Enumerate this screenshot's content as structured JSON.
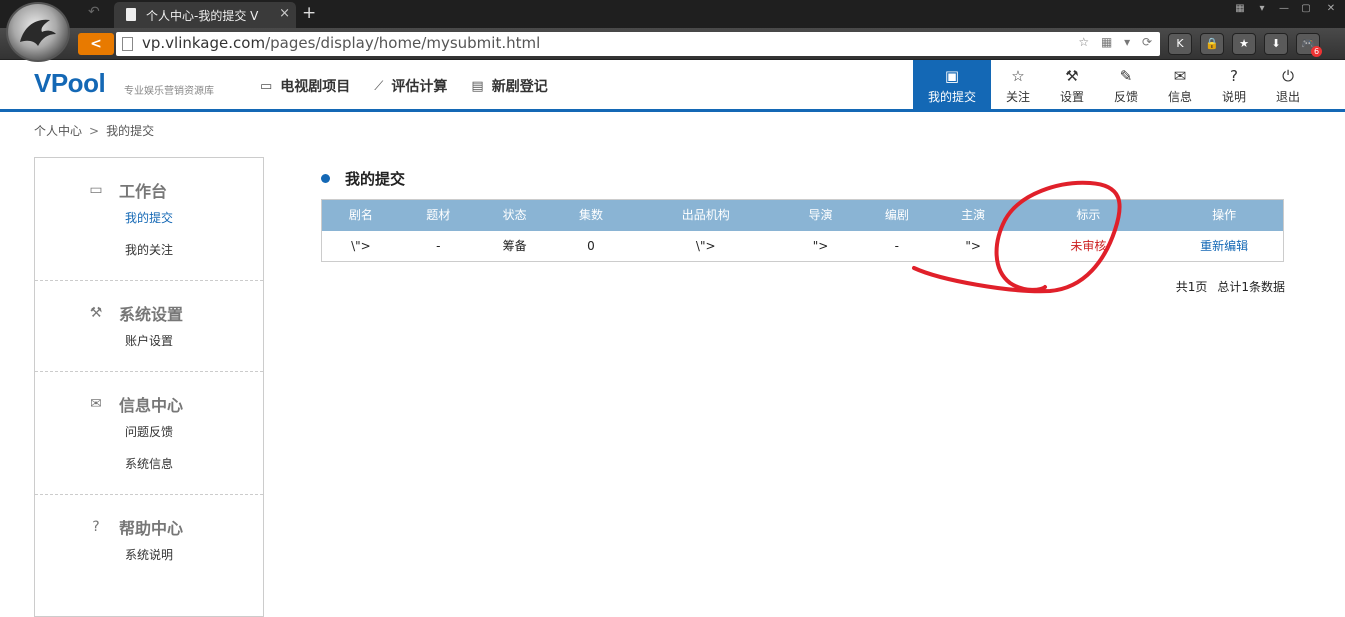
{
  "browser": {
    "tab_title": "个人中心-我的提交 V",
    "url_host": "vp.vlinkage.com",
    "url_path": "/pages/display/home/mysubmit.html",
    "new_tab": "+",
    "extensions": [
      "K",
      "🔒",
      "★",
      "⬇",
      "🎮"
    ],
    "ext_badge": "6"
  },
  "header": {
    "logo": "VPool",
    "slogan": "专业娱乐营销资源库",
    "nav": [
      {
        "label": "电视剧项目",
        "icon": "monitor-icon"
      },
      {
        "label": "评估计算",
        "icon": "chart-icon"
      },
      {
        "label": "新剧登记",
        "icon": "register-icon"
      }
    ],
    "right_nav": [
      {
        "label": "我的提交",
        "icon": "clipboard-icon",
        "active": true
      },
      {
        "label": "关注",
        "icon": "star-icon"
      },
      {
        "label": "设置",
        "icon": "wrench-icon"
      },
      {
        "label": "反馈",
        "icon": "pencil-icon"
      },
      {
        "label": "信息",
        "icon": "mail-icon"
      },
      {
        "label": "说明",
        "icon": "question-icon"
      },
      {
        "label": "退出",
        "icon": "power-icon"
      }
    ]
  },
  "breadcrumb": {
    "root": "个人中心",
    "sep": ">",
    "current": "我的提交"
  },
  "sidebar": {
    "sections": [
      {
        "title": "工作台",
        "icon": "monitor-icon",
        "links": [
          "我的提交",
          "我的关注"
        ]
      },
      {
        "title": "系统设置",
        "icon": "wrench-icon",
        "links": [
          "账户设置"
        ]
      },
      {
        "title": "信息中心",
        "icon": "mail-icon",
        "links": [
          "问题反馈",
          "系统信息"
        ]
      },
      {
        "title": "帮助中心",
        "icon": "question-icon",
        "links": [
          "系统说明"
        ]
      }
    ]
  },
  "main": {
    "title": "我的提交",
    "columns": [
      "剧名",
      "题材",
      "状态",
      "集数",
      "出品机构",
      "导演",
      "编剧",
      "主演",
      "标示",
      "操作"
    ],
    "rows": [
      [
        "\\\">",
        "-",
        "筹备",
        "0",
        "\\\">",
        "\">",
        "-",
        "\">",
        "未审核",
        "重新编辑"
      ]
    ],
    "pager": {
      "pages": "共1页",
      "total": "总计1条数据"
    }
  },
  "colors": {
    "brand": "#1468b5",
    "table_header": "#8ab4d4",
    "flag_red": "#cc2222",
    "annotation": "#e0202a"
  }
}
